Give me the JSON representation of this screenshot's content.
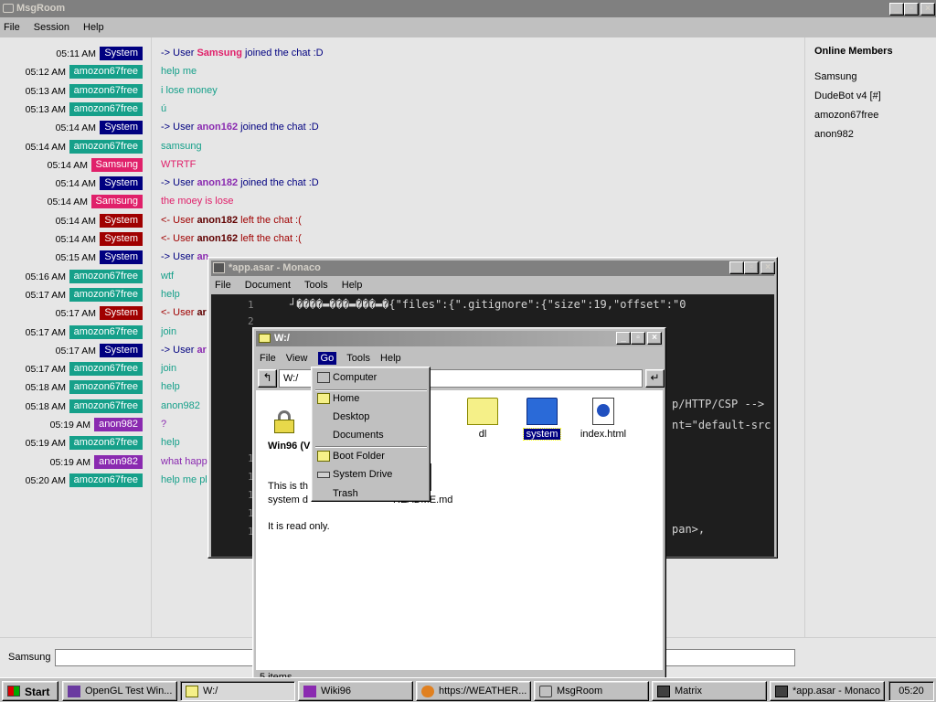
{
  "msgroom": {
    "title": "MsgRoom",
    "menu": [
      "File",
      "Session",
      "Help"
    ],
    "messages": [
      {
        "time": "05:11 AM",
        "user": "System",
        "badge_color": "#000080",
        "text_prefix": "-> User ",
        "text_user": "Samsung",
        "text_suffix": " joined the chat :D",
        "text_color": "#000080",
        "user_color": "#e0206a"
      },
      {
        "time": "05:12 AM",
        "user": "amozon67free",
        "badge_color": "#16a08a",
        "text": "help me",
        "text_color": "#16a08a"
      },
      {
        "time": "05:13 AM",
        "user": "amozon67free",
        "badge_color": "#16a08a",
        "text": "i lose money",
        "text_color": "#16a08a"
      },
      {
        "time": "05:13 AM",
        "user": "amozon67free",
        "badge_color": "#16a08a",
        "text": "ú",
        "text_color": "#16a08a"
      },
      {
        "time": "05:14 AM",
        "user": "System",
        "badge_color": "#000080",
        "text_prefix": "-> User ",
        "text_user": "anon162",
        "text_suffix": " joined the chat :D",
        "text_color": "#000080",
        "user_color": "#8a2ab0"
      },
      {
        "time": "05:14 AM",
        "user": "amozon67free",
        "badge_color": "#16a08a",
        "text": "samsung",
        "text_color": "#16a08a"
      },
      {
        "time": "05:14 AM",
        "user": "Samsung",
        "badge_color": "#e0206a",
        "text": "WTRTF",
        "text_color": "#e0206a"
      },
      {
        "time": "05:14 AM",
        "user": "System",
        "badge_color": "#000080",
        "text_prefix": "-> User ",
        "text_user": "anon182",
        "text_suffix": " joined the chat :D",
        "text_color": "#000080",
        "user_color": "#8a2ab0"
      },
      {
        "time": "05:14 AM",
        "user": "Samsung",
        "badge_color": "#e0206a",
        "text": "the moey is lose",
        "text_color": "#e0206a"
      },
      {
        "time": "05:14 AM",
        "user": "System",
        "badge_color": "#a00000",
        "text_prefix": "<- User ",
        "text_user": "anon182",
        "text_suffix": " left the chat :(",
        "text_color": "#a00000",
        "user_color": "#600000"
      },
      {
        "time": "05:14 AM",
        "user": "System",
        "badge_color": "#a00000",
        "text_prefix": "<- User ",
        "text_user": "anon162",
        "text_suffix": " left the chat :(",
        "text_color": "#a00000",
        "user_color": "#600000"
      },
      {
        "time": "05:15 AM",
        "user": "System",
        "badge_color": "#000080",
        "text_prefix": "-> User ",
        "text_user": "an",
        "text_suffix": "",
        "text_color": "#000080",
        "user_color": "#8a2ab0"
      },
      {
        "time": "05:16 AM",
        "user": "amozon67free",
        "badge_color": "#16a08a",
        "text": "wtf",
        "text_color": "#16a08a"
      },
      {
        "time": "05:17 AM",
        "user": "amozon67free",
        "badge_color": "#16a08a",
        "text": "help",
        "text_color": "#16a08a"
      },
      {
        "time": "05:17 AM",
        "user": "System",
        "badge_color": "#a00000",
        "text_prefix": "<- User ",
        "text_user": "ar",
        "text_suffix": "",
        "text_color": "#a00000",
        "user_color": "#600000"
      },
      {
        "time": "05:17 AM",
        "user": "amozon67free",
        "badge_color": "#16a08a",
        "text": "join",
        "text_color": "#16a08a"
      },
      {
        "time": "05:17 AM",
        "user": "System",
        "badge_color": "#000080",
        "text_prefix": "-> User ",
        "text_user": "ar",
        "text_suffix": "",
        "text_color": "#000080",
        "user_color": "#8a2ab0"
      },
      {
        "time": "05:17 AM",
        "user": "amozon67free",
        "badge_color": "#16a08a",
        "text": "join",
        "text_color": "#16a08a"
      },
      {
        "time": "05:18 AM",
        "user": "amozon67free",
        "badge_color": "#16a08a",
        "text": "help",
        "text_color": "#16a08a"
      },
      {
        "time": "05:18 AM",
        "user": "amozon67free",
        "badge_color": "#16a08a",
        "text": "anon982",
        "text_color": "#16a08a"
      },
      {
        "time": "05:19 AM",
        "user": "anon982",
        "badge_color": "#8a2ab0",
        "text": "?",
        "text_color": "#8a2ab0"
      },
      {
        "time": "05:19 AM",
        "user": "amozon67free",
        "badge_color": "#16a08a",
        "text": "help",
        "text_color": "#16a08a"
      },
      {
        "time": "05:19 AM",
        "user": "anon982",
        "badge_color": "#8a2ab0",
        "text": "what happ",
        "text_color": "#8a2ab0"
      },
      {
        "time": "05:20 AM",
        "user": "amozon67free",
        "badge_color": "#16a08a",
        "text": "help me pl",
        "text_color": "#16a08a"
      }
    ],
    "online_title": "Online Members",
    "online": [
      {
        "name": "Samsung",
        "color": "#e0206a"
      },
      {
        "name": "DudeBot v4 [#]",
        "color": "#e0206a"
      },
      {
        "name": "amozon67free",
        "color": "#16a08a"
      },
      {
        "name": "anon982",
        "color": "#8a2ab0"
      }
    ],
    "input_label": "Samsung",
    "input_value": ""
  },
  "monaco": {
    "title": "*app.asar - Monaco",
    "menu": [
      "File",
      "Document",
      "Tools",
      "Help"
    ],
    "lines": [
      {
        "n": "1",
        "code": "┘����▬���▬���▬�{\"files\":{\".gitignore\":{\"size\":19,\"offset\":\"0"
      },
      {
        "n": "2",
        "code": ""
      }
    ],
    "fragments": [
      "p/HTTP/CSP -->",
      "nt=\"default-src",
      "pan>,"
    ]
  },
  "explorer": {
    "title": "W:/",
    "menu": [
      "File",
      "View",
      "Go",
      "Tools",
      "Help"
    ],
    "address": "W:/",
    "side_title": "Win96 (V",
    "side_desc_1": "This is th",
    "side_desc_2": "system d",
    "side_desc_3": "It is read only.",
    "files": [
      {
        "name": "dl",
        "type": "folder"
      },
      {
        "name": "system",
        "type": "folder-selected"
      },
      {
        "name": "index.html",
        "type": "html"
      },
      {
        "name": "README.md",
        "type": "doc"
      }
    ],
    "status": "5 items"
  },
  "go_menu": {
    "items": [
      "Computer",
      "Home",
      "Desktop",
      "Documents",
      "Boot Folder",
      "System Drive",
      "Trash"
    ]
  },
  "taskbar": {
    "start": "Start",
    "tasks": [
      "OpenGL Test Win...",
      "W:/",
      "Wiki96",
      "https://WEATHER...",
      "MsgRoom",
      "Matrix",
      "*app.asar - Monaco"
    ],
    "clock": "05:20"
  }
}
